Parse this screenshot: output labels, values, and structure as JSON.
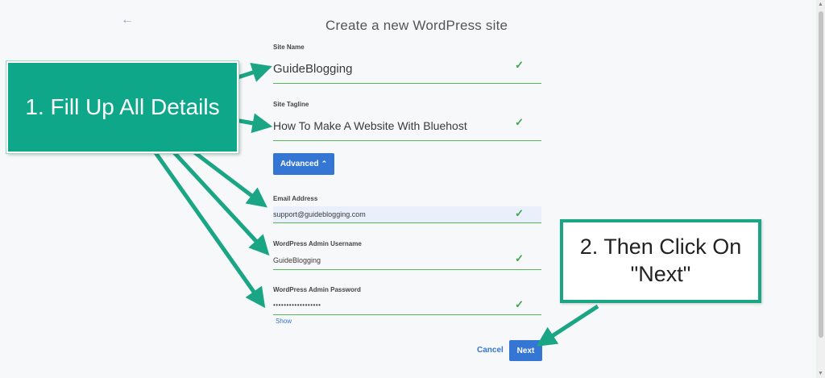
{
  "header": {
    "title": "Create a new WordPress site",
    "back_icon": "arrow-left-icon"
  },
  "form": {
    "site_name": {
      "label": "Site Name",
      "value": "GuideBlogging",
      "valid": true
    },
    "site_tagline": {
      "label": "Site Tagline",
      "value": "How To Make A Website With Bluehost",
      "valid": true
    },
    "advanced_label": "Advanced",
    "email": {
      "label": "Email Address",
      "value": "support@guideblogging.com",
      "valid": true
    },
    "username": {
      "label": "WordPress Admin Username",
      "value": "GuideBlogging",
      "valid": true
    },
    "password": {
      "label": "WordPress Admin Password",
      "value": "••••••••••••••••••",
      "valid": true
    },
    "show_label": "Show",
    "cancel_label": "Cancel",
    "next_label": "Next"
  },
  "annotations": {
    "callout1": "1. Fill Up All Details",
    "callout2_line1": "2. Then Click On",
    "callout2_line2": "\"Next\""
  },
  "colors": {
    "accent": "#3575d3",
    "valid": "#59b65a",
    "callout": "#0fa789"
  }
}
